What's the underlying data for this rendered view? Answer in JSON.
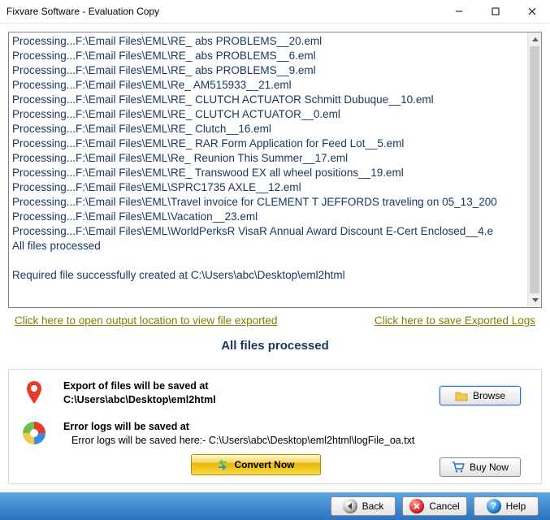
{
  "window": {
    "title": "Fixvare Software - Evaluation Copy"
  },
  "log": {
    "lines": [
      "Processing...F:\\Email Files\\EML\\RE_ abs PROBLEMS__20.eml",
      "Processing...F:\\Email Files\\EML\\RE_ abs PROBLEMS__6.eml",
      "Processing...F:\\Email Files\\EML\\RE_ abs PROBLEMS__9.eml",
      "Processing...F:\\Email Files\\EML\\Re_ AM515933__21.eml",
      "Processing...F:\\Email Files\\EML\\RE_ CLUTCH ACTUATOR Schmitt Dubuque__10.eml",
      "Processing...F:\\Email Files\\EML\\RE_ CLUTCH ACTUATOR__0.eml",
      "Processing...F:\\Email Files\\EML\\RE_ Clutch__16.eml",
      "Processing...F:\\Email Files\\EML\\RE_ RAR Form Application for Feed Lot__5.eml",
      "Processing...F:\\Email Files\\EML\\Re_ Reunion This Summer__17.eml",
      "Processing...F:\\Email Files\\EML\\RE_ Transwood EX all wheel positions__19.eml",
      "Processing...F:\\Email Files\\EML\\SPRC1735 AXLE__12.eml",
      "Processing...F:\\Email Files\\EML\\Travel invoice for CLEMENT T JEFFORDS traveling on 05_13_200",
      "Processing...F:\\Email Files\\EML\\Vacation__23.eml",
      "Processing...F:\\Email Files\\EML\\WorldPerksR VisaR Annual Award Discount E-Cert Enclosed__4.e",
      "All files processed",
      "",
      "Required file successfully created at C:\\Users\\abc\\Desktop\\eml2html"
    ]
  },
  "links": {
    "open_output": "Click here to open output location to view file exported",
    "save_logs": "Click here to save Exported Logs"
  },
  "status": {
    "heading": "All files processed"
  },
  "panel": {
    "export_label": "Export of files will be saved at",
    "export_path": "C:\\Users\\abc\\Desktop\\eml2html",
    "error_label": "Error logs will be saved at",
    "error_path": "Error logs will be saved here:- C:\\Users\\abc\\Desktop\\eml2html\\logFile_oa.txt",
    "browse_label": "Browse",
    "convert_label": "Convert Now",
    "buynow_label": "Buy Now"
  },
  "footer": {
    "back": "Back",
    "cancel": "Cancel",
    "help": "Help"
  }
}
